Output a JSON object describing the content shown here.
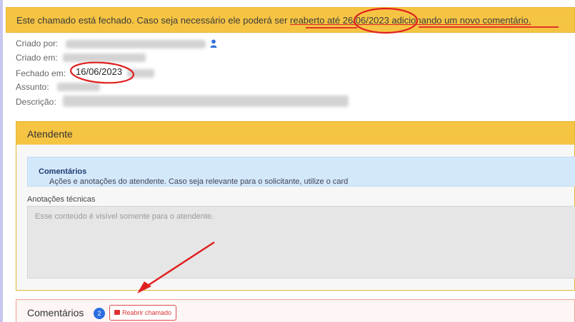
{
  "alert": {
    "text_before": "Este chamado está fechado. Caso seja necessário ele poderá ser ",
    "text_link": "reaberto até 26/06/2023 adicionando um novo comentário."
  },
  "details": {
    "created_by_label": "Criado por:",
    "created_at_label": "Criado em:",
    "closed_at_label": "Fechado em:",
    "closed_at_value": "16/06/2023",
    "subject_label": "Assunto:",
    "description_label": "Descrição:"
  },
  "attendant_card": {
    "title": "Atendente",
    "info_text": "Ações e anotações do atendente. Caso seja relevante para o solicitante, utilize o card ",
    "info_bold": "Comentários",
    "info_end": ".",
    "notes_label": "Anotações técnicas",
    "notes_placeholder": "Esse conteúdo é visível somente para o atendente."
  },
  "comments_card": {
    "title": "Comentários",
    "count": "2",
    "reopen_label": "Reabrir chamado"
  },
  "colors": {
    "warning": "#f6c443",
    "info": "#d3e8fb",
    "danger": "#e04b4b",
    "annotation": "#e02020"
  },
  "icons": {
    "user": "user-icon",
    "lock": "unlock-icon"
  }
}
